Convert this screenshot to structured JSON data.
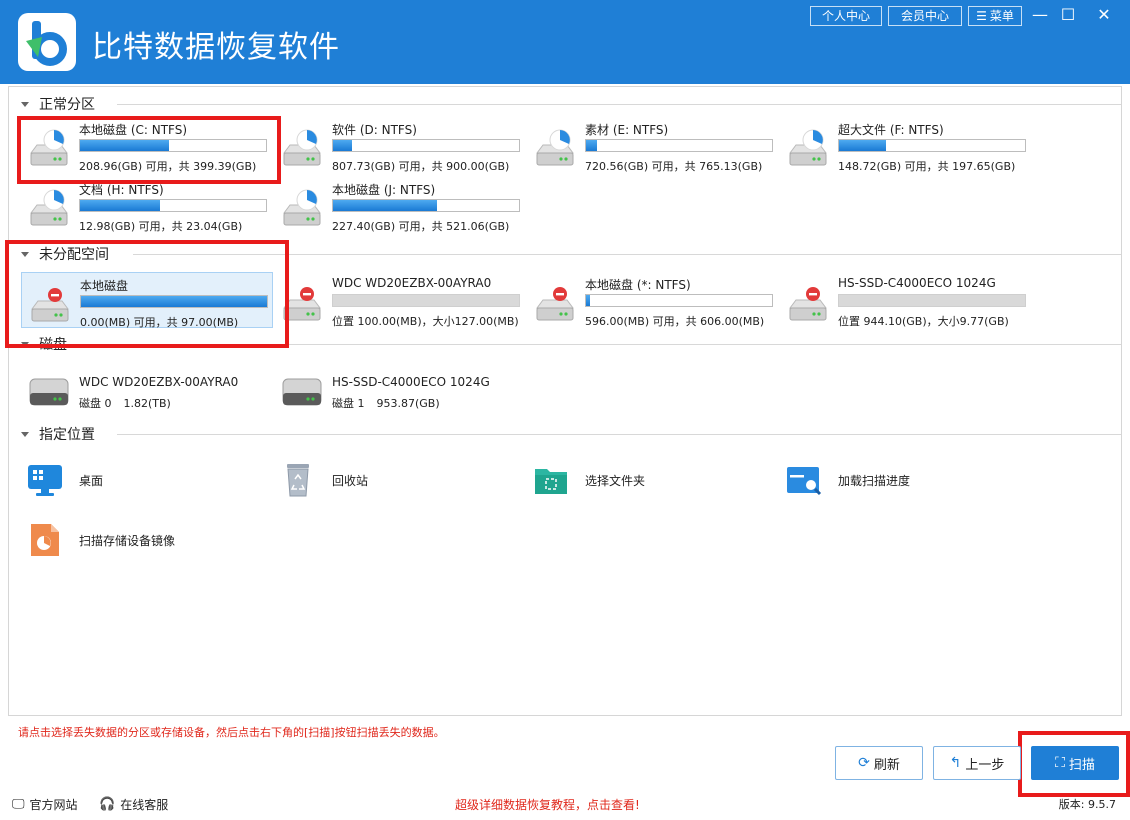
{
  "app": {
    "title": "比特数据恢复软件"
  },
  "titlebar": {
    "personal_center": "个人中心",
    "member_center": "会员中心",
    "menu": "菜单"
  },
  "sections": {
    "normal": "正常分区",
    "unallocated": "未分配空间",
    "disks": "磁盘",
    "locations": "指定位置"
  },
  "normal_partitions": [
    {
      "name": "本地磁盘 (C: NTFS)",
      "info": "208.96(GB) 可用，共 399.39(GB)",
      "used_fraction": 0.48
    },
    {
      "name": "软件 (D: NTFS)",
      "info": "807.73(GB) 可用，共 900.00(GB)",
      "used_fraction": 0.1
    },
    {
      "name": "素材 (E: NTFS)",
      "info": "720.56(GB) 可用，共 765.13(GB)",
      "used_fraction": 0.06
    },
    {
      "name": "超大文件 (F: NTFS)",
      "info": "148.72(GB) 可用，共 197.65(GB)",
      "used_fraction": 0.25
    },
    {
      "name": "文档 (H: NTFS)",
      "info": "12.98(GB) 可用，共 23.04(GB)",
      "used_fraction": 0.43
    },
    {
      "name": "本地磁盘 (J: NTFS)",
      "info": "227.40(GB) 可用，共 521.06(GB)",
      "used_fraction": 0.56
    }
  ],
  "unallocated": [
    {
      "name": "本地磁盘",
      "info": "0.00(MB) 可用，共 97.00(MB)",
      "used_fraction": 1.0,
      "selected": true
    },
    {
      "name": "WDC WD20EZBX-00AYRA0",
      "info": "位置 100.00(MB)，大小127.00(MB)",
      "used_fraction": 0,
      "gray": true
    },
    {
      "name": "本地磁盘 (*: NTFS)",
      "info": "596.00(MB) 可用，共 606.00(MB)",
      "used_fraction": 0.02
    },
    {
      "name": "HS-SSD-C4000ECO 1024G",
      "info": "位置 944.10(GB)，大小9.77(GB)",
      "used_fraction": 0,
      "gray": true
    }
  ],
  "disks": [
    {
      "name": "WDC WD20EZBX-00AYRA0",
      "label": "磁盘 0",
      "size": "1.82(TB)"
    },
    {
      "name": "HS-SSD-C4000ECO 1024G",
      "label": "磁盘 1",
      "size": "953.87(GB)"
    }
  ],
  "locations": [
    {
      "name": "桌面",
      "icon": "desktop-icon"
    },
    {
      "name": "回收站",
      "icon": "recycle-bin-icon"
    },
    {
      "name": "选择文件夹",
      "icon": "folder-icon"
    },
    {
      "name": "加载扫描进度",
      "icon": "load-progress-icon"
    },
    {
      "name": "扫描存储设备镜像",
      "icon": "disk-image-icon"
    }
  ],
  "hint": "请点击选择丢失数据的分区或存储设备，然后点击右下角的[扫描]按钮扫描丢失的数据。",
  "buttons": {
    "refresh": "刷新",
    "back": "上一步",
    "scan": "扫描"
  },
  "footer": {
    "website": "官方网站",
    "support": "在线客服",
    "tutorial": "超级详细数据恢复教程，点击查看!",
    "version": "版本: 9.5.7"
  },
  "colors": {
    "brand": "#1f7fd6",
    "highlight": "#e81b1b",
    "hint": "#e0281c"
  }
}
